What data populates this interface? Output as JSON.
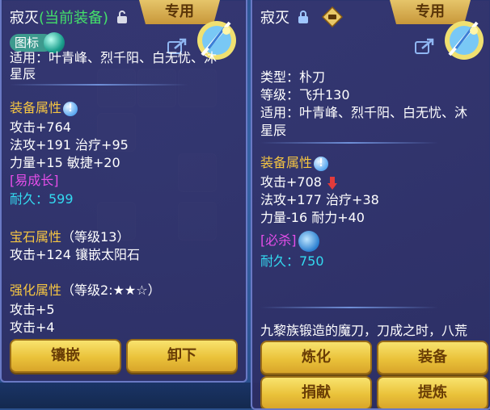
{
  "left_panel": {
    "title_name": "寂灭",
    "title_status": "(当前装备)",
    "ribbon": "专用",
    "tag": "图标",
    "applicable_partial": "适用：叶青峰、烈千阳、白无忧、沐",
    "applicable_tail": "星辰",
    "equip_attr_title": "装备属性",
    "attrs": [
      "攻击+764",
      "法攻+191 治疗+95",
      "力量+15 敏捷+20"
    ],
    "special": "[易成长]",
    "durability": "耐久：599",
    "gem_title": "宝石属性",
    "gem_level": "（等级13）",
    "gem_attr": "攻击+124 镶嵌太阳石",
    "enhance_title": "强化属性",
    "enhance_level": "（等级2:★★☆）",
    "enhance_attrs": [
      "攻击+5",
      "攻击+4"
    ],
    "buttons": [
      "镶嵌",
      "卸下"
    ]
  },
  "right_panel": {
    "title_name": "寂灭",
    "ribbon": "专用",
    "type": "类型：朴刀",
    "level": "等级：飞升130",
    "applicable": "适用：叶青峰、烈千阳、白无忧、沐",
    "applicable_tail": "星辰",
    "equip_attr_title": "装备属性",
    "attrs": [
      "攻击+708",
      "法攻+177 治疗+38",
      "力量-16 耐力+40"
    ],
    "special": "[必杀]",
    "durability": "耐久：750",
    "description": "九黎族锻造的魔刀，刀成之时，八荒",
    "buttons": [
      "炼化",
      "装备",
      "捐献",
      "提炼"
    ]
  },
  "colors": {
    "gold": "#f5c542",
    "magenta": "#e54ee9",
    "cyan": "#33d9f0",
    "green": "#44e06a",
    "down_arrow": "#e23b3b"
  },
  "icons": {
    "lock_open": "lock-open-icon",
    "lock_closed": "lock-icon",
    "share": "share-icon",
    "info": "info-icon",
    "compare": "compare-icon"
  }
}
